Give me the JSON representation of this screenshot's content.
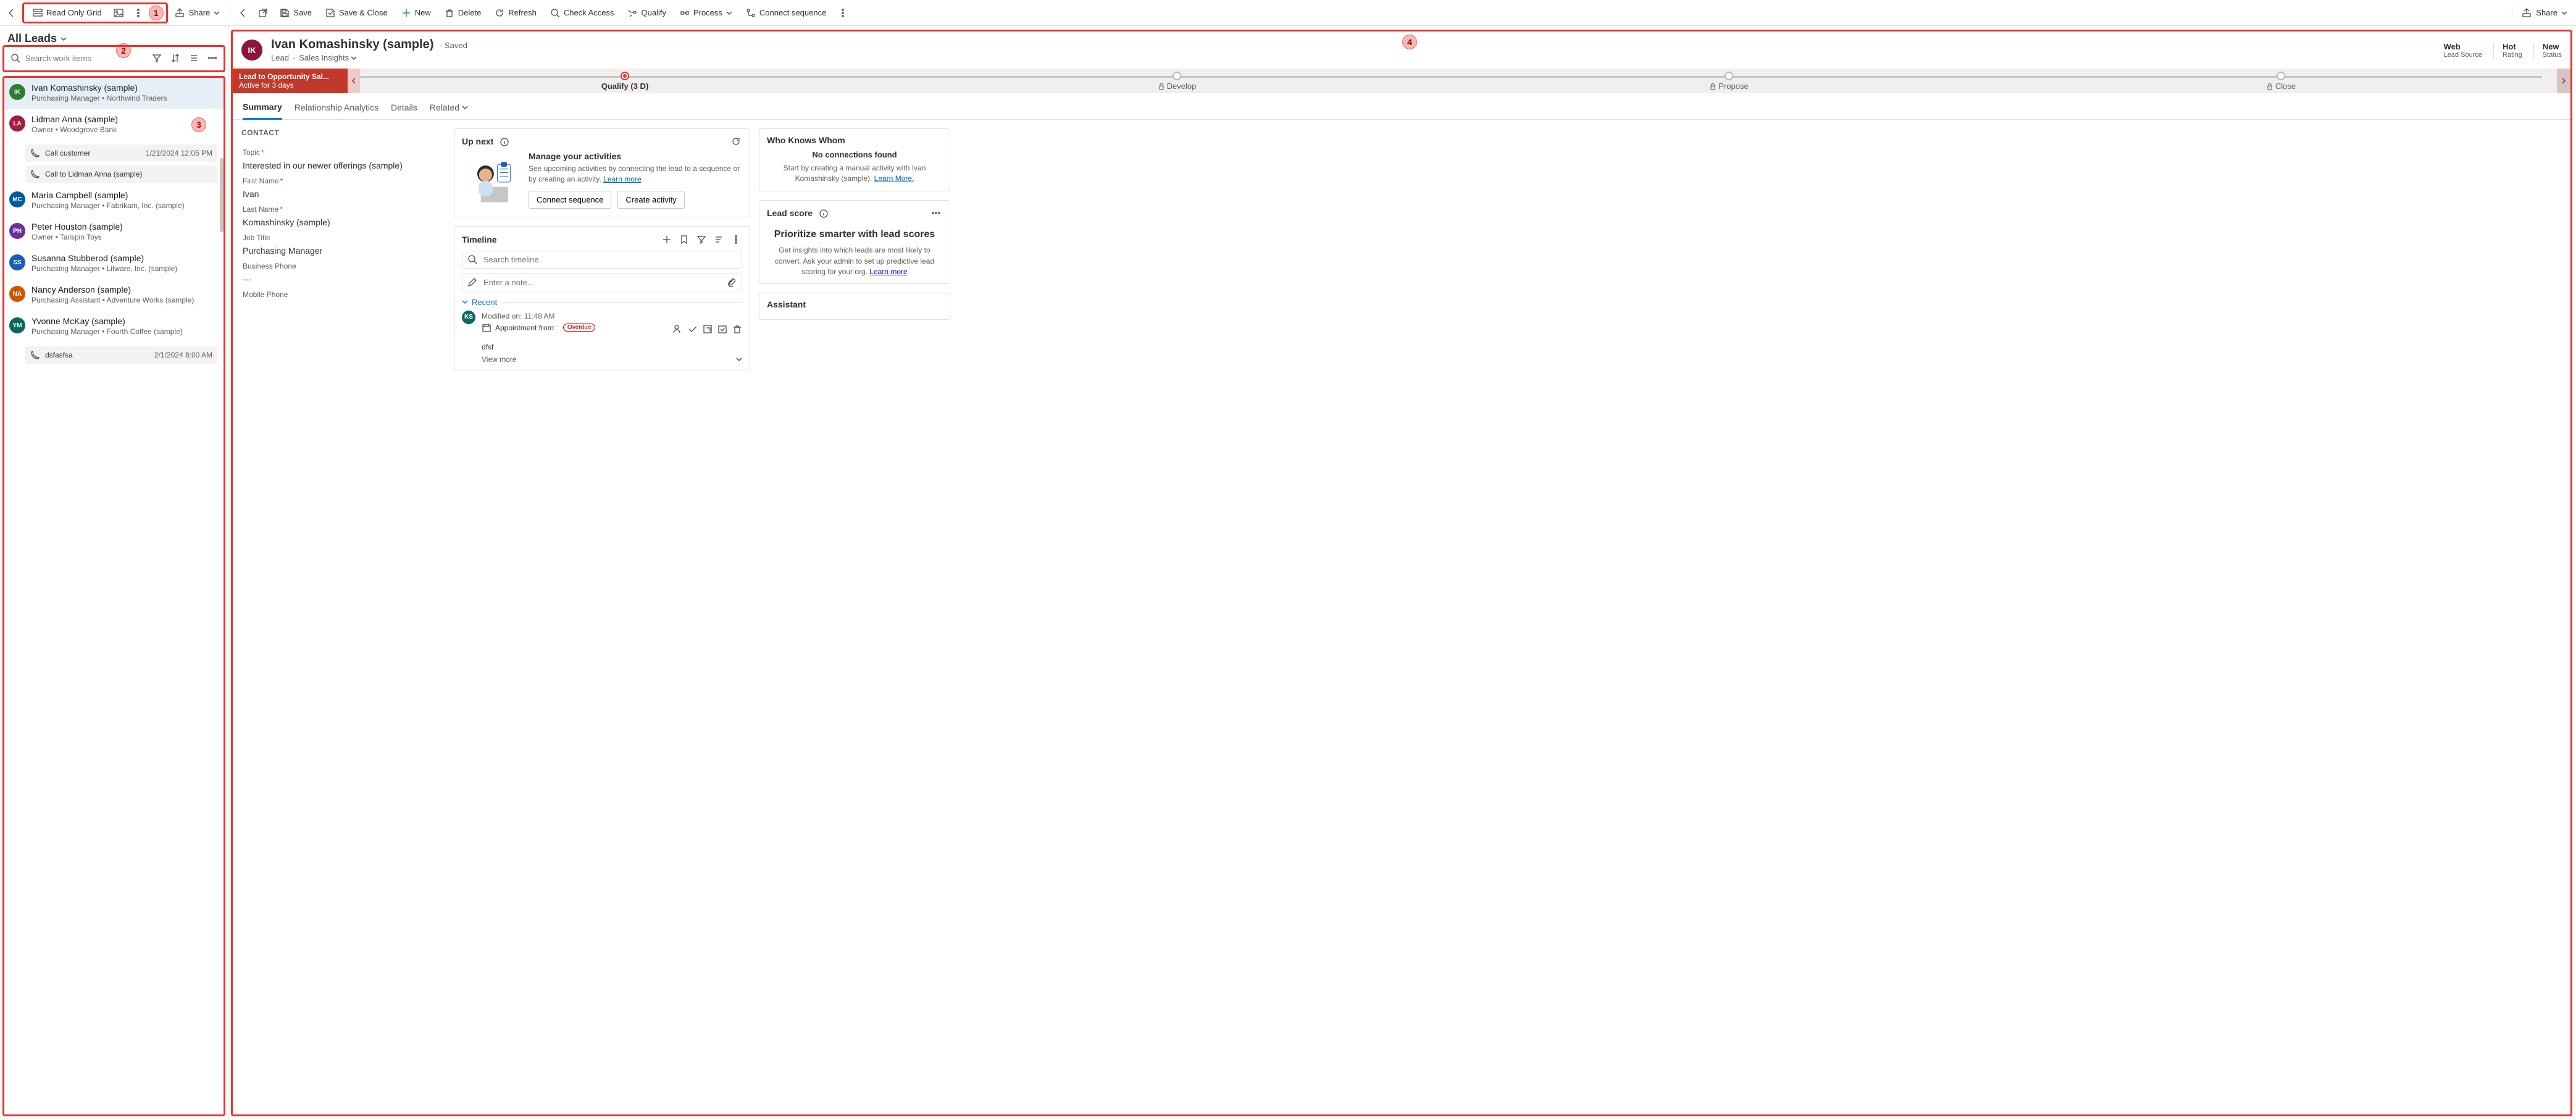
{
  "toolbar": {
    "back_left": "Back",
    "grid_label": "Read Only Grid",
    "share_label": "Share",
    "nav_back": "Back",
    "nav_new_window": "Open in new window",
    "save": "Save",
    "save_close": "Save & Close",
    "new": "New",
    "delete": "Delete",
    "refresh": "Refresh",
    "check_access": "Check Access",
    "qualify": "Qualify",
    "process": "Process",
    "connect_seq": "Connect sequence"
  },
  "left": {
    "view_name": "All Leads",
    "search_placeholder": "Search work items",
    "items": [
      {
        "initials": "IK",
        "name": "Ivan Komashinsky (sample)",
        "sub": "Purchasing Manager • Northwind Traders",
        "avatar": "#2e7d32",
        "selected": true
      },
      {
        "initials": "LA",
        "name": "Lidman Anna (sample)",
        "sub": "Owner • Woodgrove Bank",
        "avatar": "#a61c3c",
        "activities": [
          {
            "label": "Call customer",
            "time": "1/21/2024 12:05 PM"
          },
          {
            "label": "Call to Lidman Anna (sample)"
          }
        ]
      },
      {
        "initials": "MC",
        "name": "Maria Campbell (sample)",
        "sub": "Purchasing Manager • Fabrikam, Inc. (sample)",
        "avatar": "#005a9e"
      },
      {
        "initials": "PH",
        "name": "Peter Houston (sample)",
        "sub": "Owner • Tailspin Toys",
        "avatar": "#6b2fa0"
      },
      {
        "initials": "SS",
        "name": "Susanna Stubberod (sample)",
        "sub": "Purchasing Manager • Litware, Inc. (sample)",
        "avatar": "#1a5fb4"
      },
      {
        "initials": "NA",
        "name": "Nancy Anderson (sample)",
        "sub": "Purchasing Assistant • Adventure Works (sample)",
        "avatar": "#d35400"
      },
      {
        "initials": "YM",
        "name": "Yvonne McKay (sample)",
        "sub": "Purchasing Manager • Fourth Coffee (sample)",
        "avatar": "#0b6a5d",
        "activities": [
          {
            "label": "dsfasfsa",
            "time": "2/1/2024 8:00 AM"
          }
        ]
      }
    ]
  },
  "record": {
    "avatar": "IK",
    "avatar_color": "#8e1537",
    "title": "Ivan Komashinsky (sample)",
    "saved": "- Saved",
    "entity": "Lead",
    "form": "Sales Insights",
    "meta": [
      {
        "value": "Web",
        "label": "Lead Source"
      },
      {
        "value": "Hot",
        "label": "Rating"
      },
      {
        "value": "New",
        "label": "Status"
      }
    ]
  },
  "process": {
    "name": "Lead to Opportunity Sal...",
    "duration": "Active for 3 days",
    "stages": [
      {
        "label": "Qualify",
        "suffix": "(3 D)",
        "active": true,
        "locked": false
      },
      {
        "label": "Develop",
        "locked": true
      },
      {
        "label": "Propose",
        "locked": true
      },
      {
        "label": "Close",
        "locked": true
      }
    ]
  },
  "tabs": [
    "Summary",
    "Relationship Analytics",
    "Details",
    "Related"
  ],
  "contact": {
    "section": "CONTACT",
    "fields": [
      {
        "label": "Topic",
        "required": true,
        "value": "Interested in our newer offerings (sample)"
      },
      {
        "label": "First Name",
        "required": true,
        "value": "Ivan"
      },
      {
        "label": "Last Name",
        "required": true,
        "value": "Komashinsky (sample)"
      },
      {
        "label": "Job Title",
        "value": "Purchasing Manager"
      },
      {
        "label": "Business Phone",
        "value": "---"
      },
      {
        "label": "Mobile Phone",
        "value": ""
      }
    ]
  },
  "upnext": {
    "title": "Up next",
    "h": "Manage your activities",
    "p": "See upcoming activities by connecting the lead to a sequence or by creating an activity. ",
    "learn": "Learn more",
    "btn1": "Connect sequence",
    "btn2": "Create activity"
  },
  "timeline": {
    "title": "Timeline",
    "search_placeholder": "Search timeline",
    "note_placeholder": "Enter a note...",
    "recent": "Recent",
    "items": [
      {
        "av": "KS",
        "line1": "Modified on: 11:48 AM",
        "line2_icon": "calendar",
        "line2": "Appointment from:",
        "status": "Overdue",
        "line3": "dfsf",
        "more": "View more"
      }
    ]
  },
  "wkw": {
    "title": "Who Knows Whom",
    "empty_h": "No connections found",
    "empty_p": "Start by creating a manual activity with Ivan Komashinsky (sample). ",
    "learn": "Learn More."
  },
  "leadscore": {
    "title": "Lead score",
    "h": "Prioritize smarter with lead scores",
    "p": "Get insights into which leads are most likely to convert. Ask your admin to set up predictive lead scoring for your org. ",
    "learn": "Learn more"
  },
  "assistant": {
    "title": "Assistant"
  }
}
